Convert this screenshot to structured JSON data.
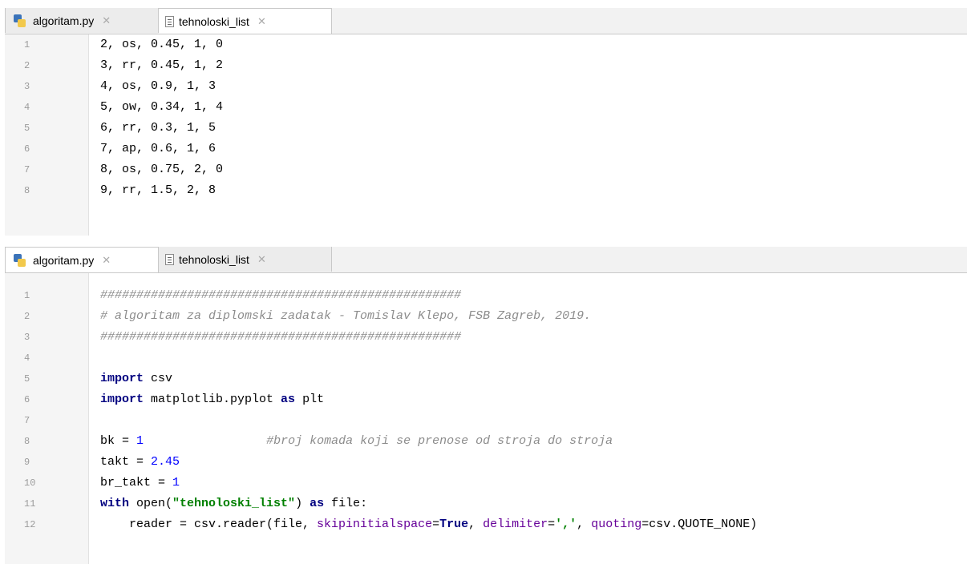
{
  "pane1": {
    "tabs": [
      {
        "label": "algoritam.py",
        "icon": "python-file-icon",
        "active": false
      },
      {
        "label": "tehnoloski_list",
        "icon": "text-file-icon",
        "active": true
      }
    ],
    "lines": [
      {
        "n": "1",
        "text": "2, os, 0.45, 1, 0"
      },
      {
        "n": "2",
        "text": "3, rr, 0.45, 1, 2"
      },
      {
        "n": "3",
        "text": "4, os, 0.9, 1, 3"
      },
      {
        "n": "4",
        "text": "5, ow, 0.34, 1, 4"
      },
      {
        "n": "5",
        "text": "6, rr, 0.3, 1, 5"
      },
      {
        "n": "6",
        "text": "7, ap, 0.6, 1, 6"
      },
      {
        "n": "7",
        "text": "8, os, 0.75, 2, 0"
      },
      {
        "n": "8",
        "text": "9, rr, 1.5, 2, 8"
      }
    ]
  },
  "pane2": {
    "tabs": [
      {
        "label": "algoritam.py",
        "icon": "python-file-icon",
        "active": true
      },
      {
        "label": "tehnoloski_list",
        "icon": "text-file-icon",
        "active": false
      }
    ],
    "lines": [
      {
        "n": "1",
        "tokens": [
          {
            "t": "##################################################",
            "c": "cmt"
          }
        ]
      },
      {
        "n": "2",
        "tokens": [
          {
            "t": "# algoritam za diplomski zadatak - Tomislav Klepo, FSB Zagreb, 2019.",
            "c": "cmt"
          }
        ]
      },
      {
        "n": "3",
        "tokens": [
          {
            "t": "##################################################",
            "c": "cmt"
          }
        ]
      },
      {
        "n": "4",
        "tokens": []
      },
      {
        "n": "5",
        "tokens": [
          {
            "t": "import",
            "c": "kw"
          },
          {
            "t": " csv",
            "c": ""
          }
        ]
      },
      {
        "n": "6",
        "tokens": [
          {
            "t": "import",
            "c": "kw"
          },
          {
            "t": " matplotlib.pyplot ",
            "c": ""
          },
          {
            "t": "as",
            "c": "kw"
          },
          {
            "t": " plt",
            "c": ""
          }
        ]
      },
      {
        "n": "7",
        "tokens": []
      },
      {
        "n": "8",
        "tokens": [
          {
            "t": "bk = ",
            "c": ""
          },
          {
            "t": "1",
            "c": "num"
          },
          {
            "t": "                 ",
            "c": ""
          },
          {
            "t": "#broj komada koji se prenose od stroja do stroja",
            "c": "cmt"
          }
        ]
      },
      {
        "n": "9",
        "tokens": [
          {
            "t": "takt = ",
            "c": ""
          },
          {
            "t": "2.45",
            "c": "num"
          }
        ]
      },
      {
        "n": "10",
        "tokens": [
          {
            "t": "br_takt = ",
            "c": ""
          },
          {
            "t": "1",
            "c": "num"
          }
        ]
      },
      {
        "n": "11",
        "tokens": [
          {
            "t": "with",
            "c": "kw"
          },
          {
            "t": " open(",
            "c": ""
          },
          {
            "t": "\"tehnoloski_list\"",
            "c": "str"
          },
          {
            "t": ") ",
            "c": ""
          },
          {
            "t": "as",
            "c": "kw"
          },
          {
            "t": " file:",
            "c": ""
          }
        ]
      },
      {
        "n": "12",
        "tokens": [
          {
            "t": "    reader = csv.reader(file, ",
            "c": ""
          },
          {
            "t": "skipinitialspace",
            "c": "kwarg"
          },
          {
            "t": "=",
            "c": ""
          },
          {
            "t": "True",
            "c": "kw"
          },
          {
            "t": ", ",
            "c": ""
          },
          {
            "t": "delimiter",
            "c": "kwarg"
          },
          {
            "t": "=",
            "c": ""
          },
          {
            "t": "','",
            "c": "str"
          },
          {
            "t": ", ",
            "c": ""
          },
          {
            "t": "quoting",
            "c": "kwarg"
          },
          {
            "t": "=csv.QUOTE_NONE)",
            "c": ""
          }
        ]
      }
    ]
  },
  "colors": {
    "comment": "#8c8c8c",
    "keyword": "#000080",
    "number": "#0000ff",
    "string": "#008000",
    "kwarg": "#660099",
    "line_number": "#9c9c9c"
  }
}
